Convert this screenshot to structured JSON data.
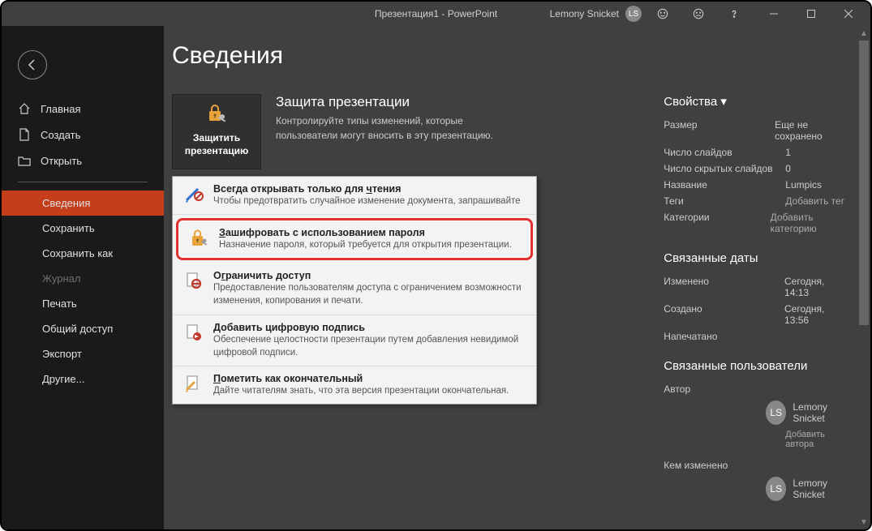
{
  "titlebar": {
    "doc_title": "Презентация1 - PowerPoint",
    "user_name": "Lemony Snicket",
    "user_initials": "LS"
  },
  "sidebar": {
    "items": [
      {
        "label": "Главная",
        "icon": "home"
      },
      {
        "label": "Создать",
        "icon": "new"
      },
      {
        "label": "Открыть",
        "icon": "open"
      }
    ],
    "items2": [
      {
        "label": "Сведения",
        "active": true
      },
      {
        "label": "Сохранить"
      },
      {
        "label": "Сохранить как"
      },
      {
        "label": "Журнал",
        "disabled": true
      },
      {
        "label": "Печать"
      },
      {
        "label": "Общий доступ"
      },
      {
        "label": "Экспорт"
      },
      {
        "label": "Другие..."
      }
    ]
  },
  "page": {
    "title": "Сведения",
    "protect_button": "Защитить презентацию",
    "protect_heading": "Защита презентации",
    "protect_desc": "Контролируйте типы изменений, которые пользователи могут вносить в эту презентацию."
  },
  "menu": [
    {
      "title_pre": "Всегда открывать только для ",
      "title_u": "ч",
      "title_post": "тения",
      "desc": "Чтобы предотвратить случайное изменение документа, запрашивайте"
    },
    {
      "title_pre": "",
      "title_u": "З",
      "title_post": "ашифровать с использованием пароля",
      "desc": "Назначение пароля, который требуется для открытия презентации.",
      "highlight": true
    },
    {
      "title_pre": "О",
      "title_u": "г",
      "title_post": "раничить доступ",
      "desc": "Предоставление пользователям доступа с ограничением возможности изменения, копирования и печати."
    },
    {
      "title_pre": "",
      "title_u": "Д",
      "title_post": "обавить цифровую подпись",
      "desc": "Обеспечение целостности презентации путем добавления невидимой цифровой подписи."
    },
    {
      "title_pre": "",
      "title_u": "П",
      "title_post": "ометить как окончательный",
      "desc": "Дайте читателям знать, что эта версия презентации окончательная."
    }
  ],
  "props": {
    "title": "Свойства ▾",
    "rows": [
      {
        "label": "Размер",
        "value": "Еще не сохранено"
      },
      {
        "label": "Число слайдов",
        "value": "1"
      },
      {
        "label": "Число скрытых слайдов",
        "value": "0"
      },
      {
        "label": "Название",
        "value": "Lumpics"
      },
      {
        "label": "Теги",
        "value": "Добавить тег",
        "link": true
      },
      {
        "label": "Категории",
        "value": "Добавить категорию",
        "link": true
      }
    ]
  },
  "dates": {
    "title": "Связанные даты",
    "rows": [
      {
        "label": "Изменено",
        "value": "Сегодня, 14:13"
      },
      {
        "label": "Создано",
        "value": "Сегодня, 13:56"
      },
      {
        "label": "Напечатано",
        "value": ""
      }
    ]
  },
  "people": {
    "title": "Связанные пользователи",
    "author_label": "Автор",
    "author_name": "Lemony Snicket",
    "author_initials": "LS",
    "add_author": "Добавить автора",
    "modified_label": "Кем изменено",
    "modified_name": "Lemony Snicket",
    "modified_initials": "LS"
  }
}
